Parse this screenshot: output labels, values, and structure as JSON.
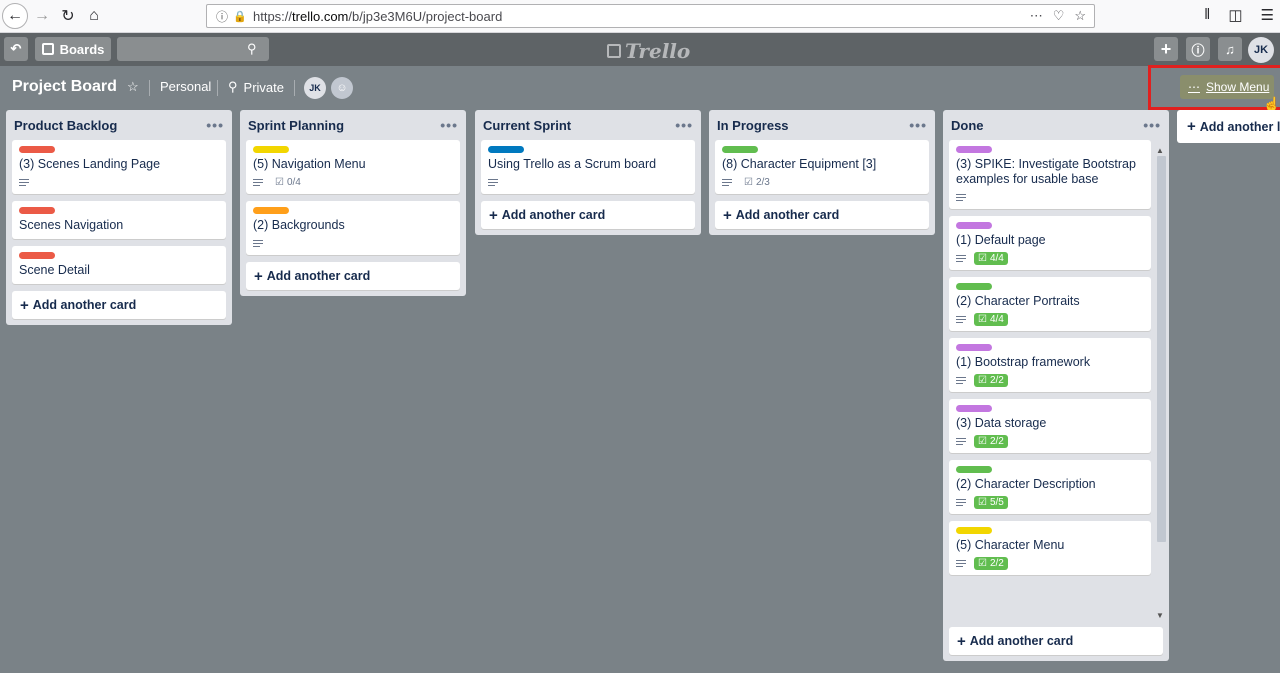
{
  "browser": {
    "url_prefix": "https://",
    "url_host": "trello.com",
    "url_path": "/b/jp3e3M6U/project-board"
  },
  "header": {
    "boards_label": "Boards",
    "logo_text": "Trello",
    "user_initials": "JK"
  },
  "board": {
    "title": "Project Board",
    "team": "Personal",
    "visibility": "Private",
    "member_initials": "JK",
    "show_menu_label": "Show Menu",
    "add_list_label": "Add another list"
  },
  "colors": {
    "red": "#eb5a46",
    "yellow": "#f2d600",
    "orange": "#ff9f1a",
    "blue": "#0079bf",
    "green": "#61bd4f",
    "purple": "#c377e0"
  },
  "add_card_label": "Add another card",
  "lists": [
    {
      "title": "Product Backlog",
      "cards": [
        {
          "label": "red",
          "title": "(3) Scenes Landing Page",
          "desc": true,
          "check": ""
        },
        {
          "label": "red",
          "title": "Scenes Navigation",
          "desc": false,
          "check": ""
        },
        {
          "label": "red",
          "title": "Scene Detail",
          "desc": false,
          "check": ""
        }
      ]
    },
    {
      "title": "Sprint Planning",
      "cards": [
        {
          "label": "yellow",
          "title": "(5) Navigation Menu",
          "desc": true,
          "check": "0/4"
        },
        {
          "label": "orange",
          "title": "(2) Backgrounds",
          "desc": true,
          "check": ""
        }
      ]
    },
    {
      "title": "Current Sprint",
      "cards": [
        {
          "label": "blue",
          "title": "Using Trello as a Scrum board",
          "desc": true,
          "check": ""
        }
      ]
    },
    {
      "title": "In Progress",
      "cards": [
        {
          "label": "green",
          "title": "(8) Character Equipment [3]",
          "desc": true,
          "check": "2/3"
        }
      ]
    },
    {
      "title": "Done",
      "cards": [
        {
          "label": "purple",
          "title": "(3) SPIKE: Investigate Bootstrap examples for usable base",
          "desc": true,
          "check": ""
        },
        {
          "label": "purple",
          "title": "(1) Default page",
          "desc": true,
          "check": "4/4",
          "done": true
        },
        {
          "label": "green",
          "title": "(2) Character Portraits",
          "desc": true,
          "check": "4/4",
          "done": true
        },
        {
          "label": "purple",
          "title": "(1) Bootstrap framework",
          "desc": true,
          "check": "2/2",
          "done": true
        },
        {
          "label": "purple",
          "title": "(3) Data storage",
          "desc": true,
          "check": "2/2",
          "done": true
        },
        {
          "label": "green",
          "title": "(2) Character Description",
          "desc": true,
          "check": "5/5",
          "done": true
        },
        {
          "label": "yellow",
          "title": "(5) Character Menu",
          "desc": true,
          "check": "2/2",
          "done": true
        }
      ]
    }
  ]
}
